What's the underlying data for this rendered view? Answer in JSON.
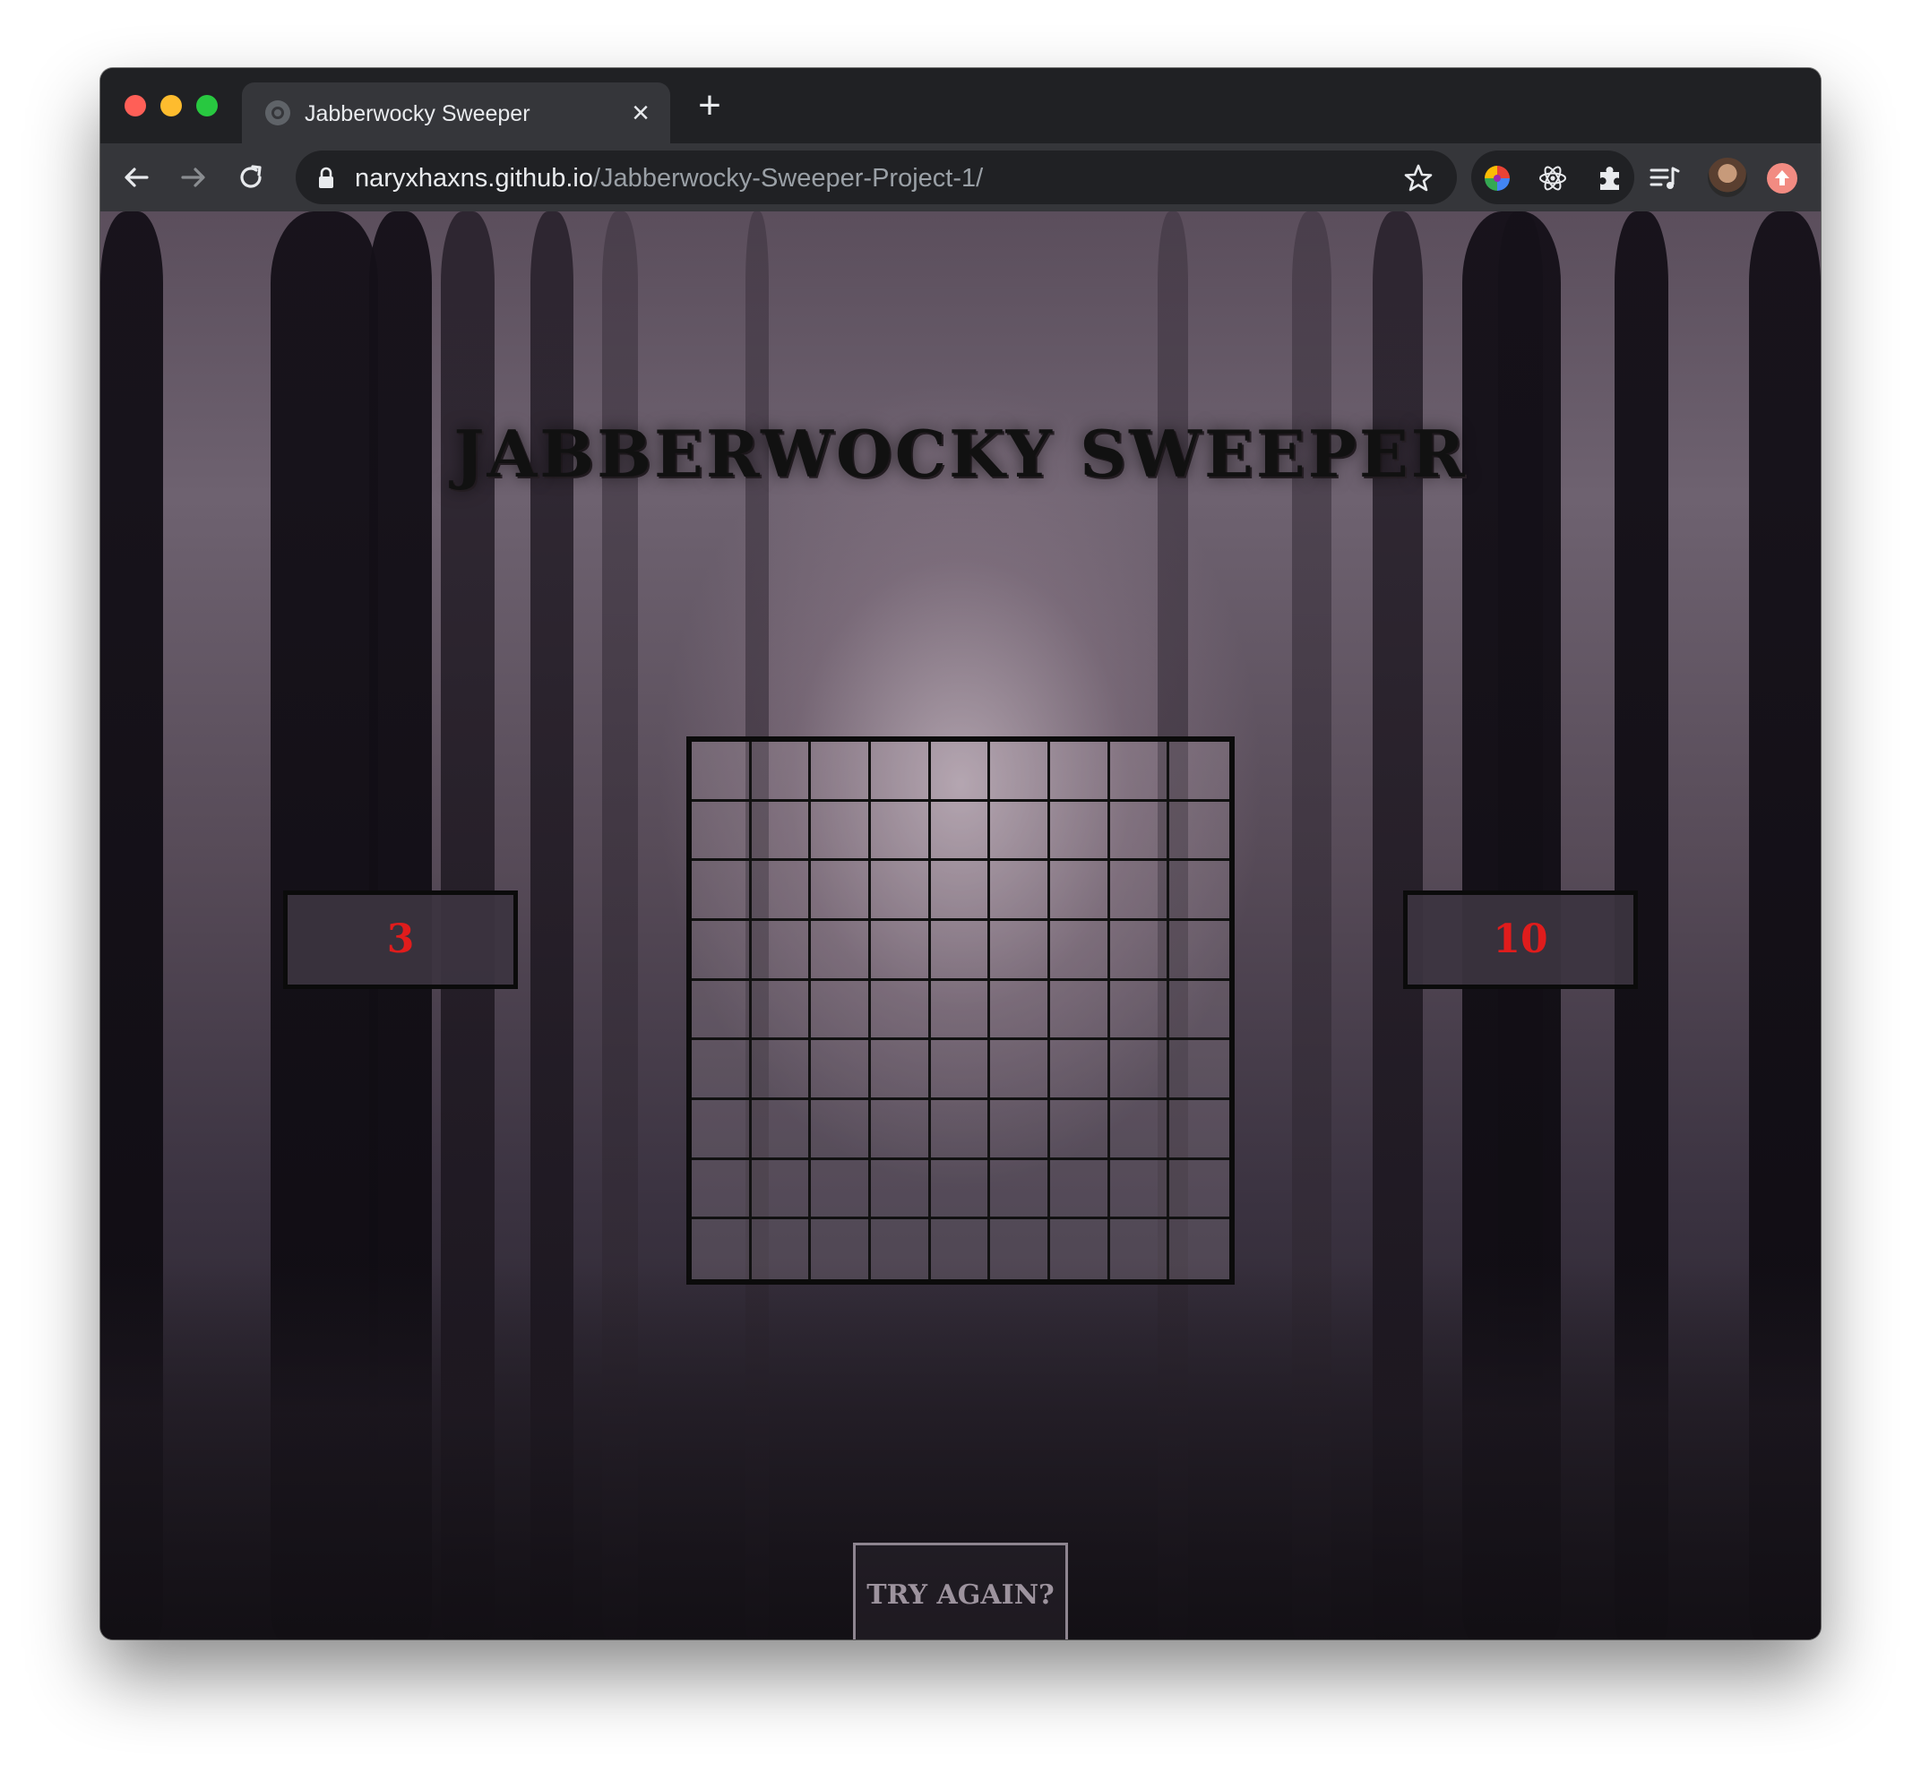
{
  "browser": {
    "tab": {
      "title": "Jabberwocky Sweeper",
      "close_symbol": "×"
    },
    "new_tab_symbol": "+",
    "address_bar": {
      "host": "naryxhaxns.github.io",
      "path": "/Jabberwocky-Sweeper-Project-1/"
    },
    "icons": [
      "back-icon",
      "forward-icon",
      "reload-icon",
      "lock-icon",
      "star-icon",
      "color-extension-icon",
      "react-devtools-icon",
      "extensions-puzzle-icon",
      "playlist-icon",
      "profile-avatar",
      "update-icon"
    ]
  },
  "game": {
    "title": "JABBERWOCKY SWEEPER",
    "left_counter": "3",
    "right_counter": "10",
    "try_again_label": "TRY AGAIN?",
    "board": {
      "rows": 9,
      "columns": 9
    }
  },
  "colors": {
    "counter_text": "#e01c1c",
    "grid_lines": "#111111",
    "chrome_dark": "#202124",
    "chrome_toolbar": "#35363a"
  }
}
